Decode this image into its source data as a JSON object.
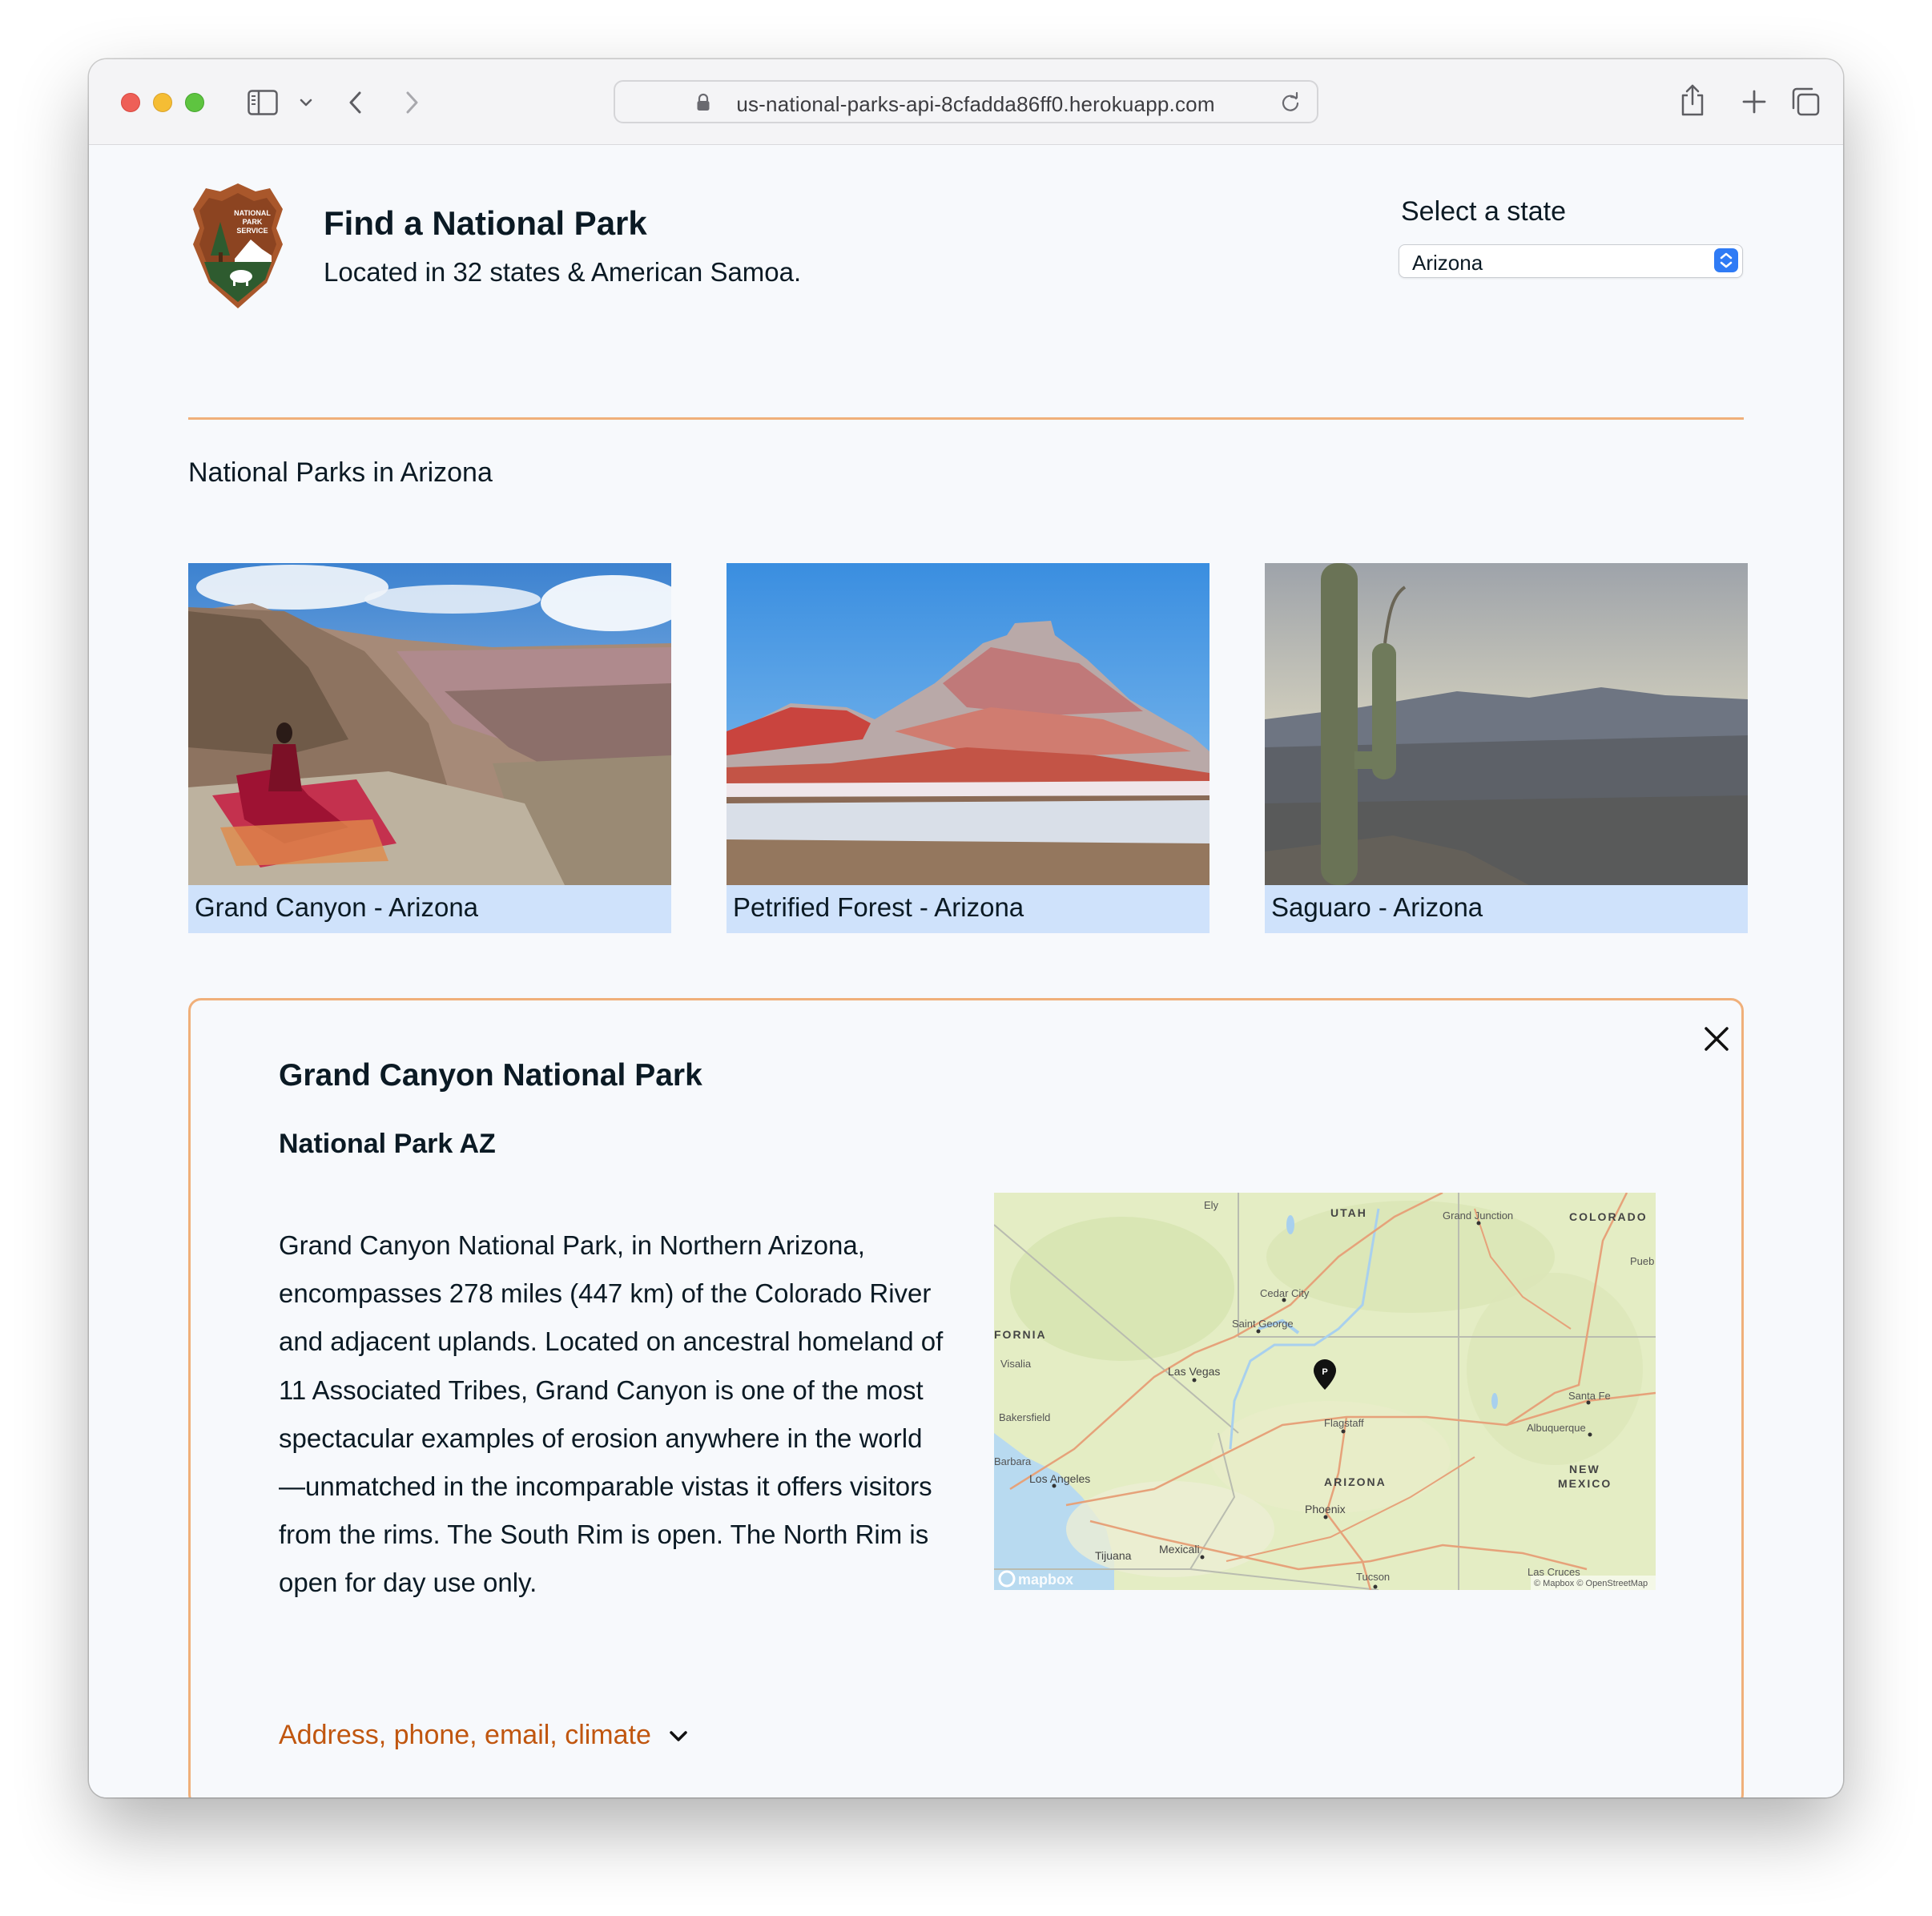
{
  "browser": {
    "url": "us-national-parks-api-8cfadda86ff0.herokuapp.com"
  },
  "header": {
    "logo_text": [
      "NATIONAL",
      "PARK",
      "SERVICE"
    ],
    "title": "Find a National Park",
    "subtitle": "Located in 32 states & American Samoa."
  },
  "state_select": {
    "label": "Select a state",
    "value": "Arizona"
  },
  "parks_section": {
    "heading": "National Parks in Arizona",
    "cards": [
      {
        "caption": "Grand Canyon - Arizona"
      },
      {
        "caption": "Petrified Forest - Arizona"
      },
      {
        "caption": "Saguaro - Arizona"
      }
    ]
  },
  "detail": {
    "name": "Grand Canyon National Park",
    "designation": "National Park AZ",
    "description": "Grand Canyon National Park, in Northern Arizona, encompasses 278 miles (447 km) of the Colorado River and adjacent uplands. Located on ancestral homeland of 11 Associated Tribes, Grand Canyon is one of the most spectacular examples of erosion anywhere in the world—unmatched in the incomparable vistas it offers visitors from the rims. The South Rim is open. The North Rim is open for day use only.",
    "details_toggle": "Address, phone, email, climate",
    "map": {
      "labels": {
        "ely": "Ely",
        "utah": "UTAH",
        "grand_junction": "Grand Junction",
        "colorado": "COLORADO",
        "pueblo": "Pueb",
        "cedar_city": "Cedar City",
        "saint_george": "Saint George",
        "california": "FORNIA",
        "visalia": "Visalia",
        "las_vegas": "Las Vegas",
        "santa_fe": "Santa Fe",
        "bakersfield": "Bakersfield",
        "flagstaff": "Flagstaff",
        "albuquerque": "Albuquerque",
        "barbara": "Barbara",
        "los_angeles": "Los Angeles",
        "arizona": "ARIZONA",
        "new": "NEW",
        "mexico": "MEXICO",
        "phoenix": "Phoenix",
        "tijuana": "Tijuana",
        "mexicali": "Mexicali",
        "tucson": "Tucson",
        "las_cruces": "Las Cruces",
        "mapbox": "mapbox",
        "attribution": "© Mapbox © OpenStreetMap",
        "marker": "P"
      }
    }
  },
  "colors": {
    "accent": "#f0b07a",
    "link": "#c0560f",
    "caption_bg": "#cfe2fb",
    "select_arrow": "#2f7bf5"
  },
  "icons": [
    "sidebar-icon",
    "chevron-down-icon",
    "back-icon",
    "forward-icon",
    "lock-icon",
    "reload-icon",
    "share-icon",
    "plus-icon",
    "tabs-icon",
    "close-icon",
    "map-pin-icon",
    "nps-arrowhead-logo"
  ]
}
